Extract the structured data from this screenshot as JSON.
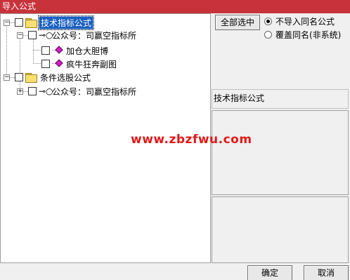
{
  "window": {
    "title": "导入公式"
  },
  "tree": {
    "nodes": [
      {
        "label": "技术指标公式",
        "icon": "folder-icon"
      },
      {
        "label": "公众号：司赢空指标所",
        "icon": "key-icon"
      },
      {
        "label": "加仓大胆博",
        "icon": "formula-icon"
      },
      {
        "label": "疯牛狂奔副图",
        "icon": "formula-icon"
      },
      {
        "label": "条件选股公式",
        "icon": "folder-icon"
      },
      {
        "label": "公众号：司赢空指标所",
        "icon": "key-icon"
      }
    ]
  },
  "options": {
    "select_all_label": "全部选中",
    "radio_no_import": "不导入同名公式",
    "radio_overwrite": "覆盖同名(非系统)",
    "selected": "no_import"
  },
  "description": {
    "title": "技术指标公式"
  },
  "watermark": "www.zbzfwu.com",
  "footer": {
    "ok_label": "确定",
    "cancel_label": "取消"
  },
  "colors": {
    "titlebar": "#c8333b",
    "selection": "#1a5fc0",
    "watermark": "#e01818"
  }
}
